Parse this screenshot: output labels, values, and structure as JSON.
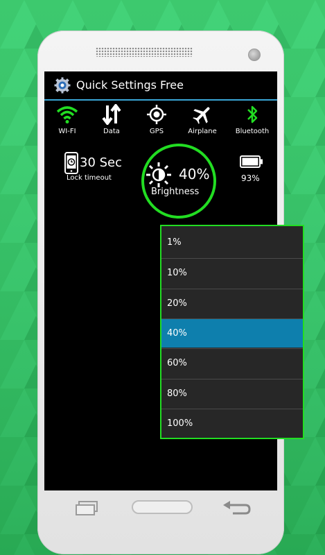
{
  "app": {
    "title": "Quick Settings Free"
  },
  "toggles": [
    {
      "label": "WI-FI",
      "icon": "wifi-icon",
      "color": "#22dd22"
    },
    {
      "label": "Data",
      "icon": "data-arrows-icon",
      "color": "#ffffff"
    },
    {
      "label": "GPS",
      "icon": "gps-icon",
      "color": "#ffffff"
    },
    {
      "label": "Airplane",
      "icon": "airplane-icon",
      "color": "#ffffff"
    },
    {
      "label": "Bluetooth",
      "icon": "bluetooth-icon",
      "color": "#22dd22"
    }
  ],
  "lock": {
    "value": "30 Sec",
    "label": "Lock timeout"
  },
  "brightness": {
    "value": "40%",
    "label": "Brightness"
  },
  "battery": {
    "value": "93%",
    "level": 0.93
  },
  "brightness_menu": {
    "options": [
      "1%",
      "10%",
      "20%",
      "40%",
      "60%",
      "80%",
      "100%"
    ],
    "selected": "40%",
    "selected_color": "#0e7fad"
  },
  "colors": {
    "accent": "#22dd22",
    "title_divider": "#3aa6d6",
    "background": "#2fb35c"
  }
}
